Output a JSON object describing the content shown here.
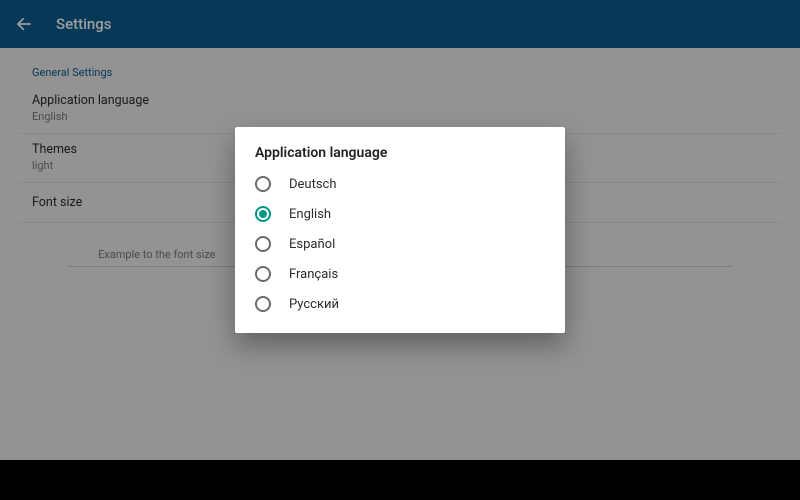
{
  "appbar": {
    "title": "Settings"
  },
  "sections": {
    "general": {
      "header": "General Settings",
      "language": {
        "label": "Application language",
        "value": "English"
      },
      "themes": {
        "label": "Themes",
        "value": "light"
      },
      "fontsize": {
        "label": "Font size"
      },
      "example": "Example to the font size"
    }
  },
  "dialog": {
    "title": "Application language",
    "options": [
      {
        "label": "Deutsch",
        "selected": false
      },
      {
        "label": "English",
        "selected": true
      },
      {
        "label": "Español",
        "selected": false
      },
      {
        "label": "Français",
        "selected": false
      },
      {
        "label": "Русский",
        "selected": false
      }
    ]
  }
}
